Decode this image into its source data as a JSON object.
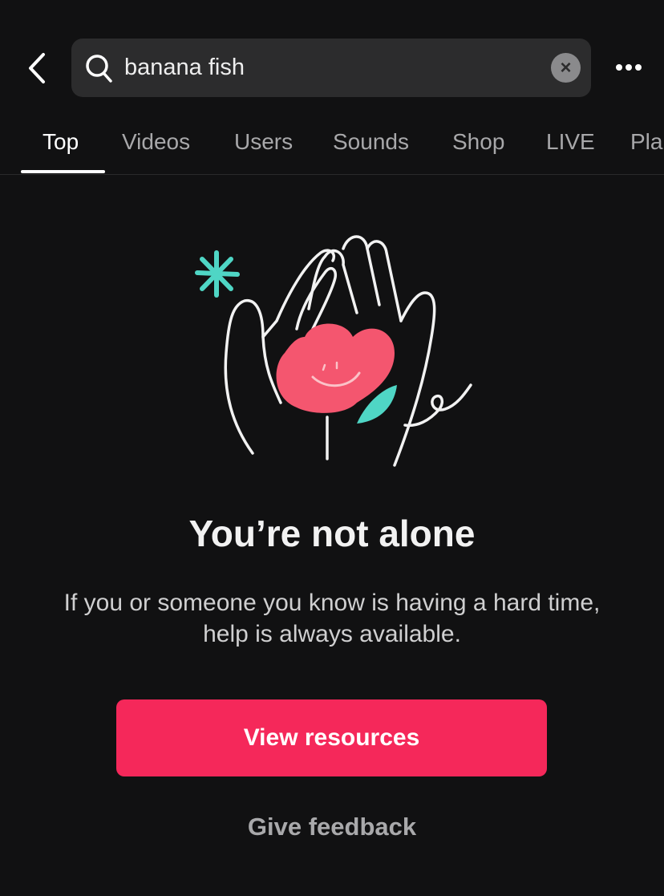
{
  "search": {
    "query": "banana fish"
  },
  "tabs": [
    {
      "label": "Top",
      "active": true
    },
    {
      "label": "Videos"
    },
    {
      "label": "Users"
    },
    {
      "label": "Sounds"
    },
    {
      "label": "Shop"
    },
    {
      "label": "LIVE"
    },
    {
      "label": "Pla"
    }
  ],
  "message": {
    "title": "You’re not alone",
    "body": "If you or someone you know is having a hard time, help is always available."
  },
  "actions": {
    "primary": "View resources",
    "secondary": "Give feedback"
  },
  "colors": {
    "accent": "#f5285a",
    "illustration_pink": "#f4566f",
    "illustration_teal": "#4fd6c5",
    "background": "#111112"
  },
  "icons": [
    "chevron-left-icon",
    "search-icon",
    "clear-icon",
    "more-icon"
  ]
}
